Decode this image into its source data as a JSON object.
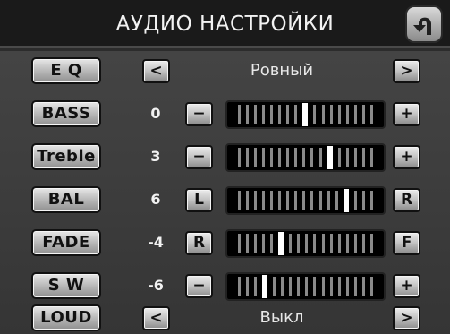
{
  "header": {
    "title": "АУДИО НАСТРОЙКИ",
    "back_icon": "back-arrow-icon"
  },
  "eq": {
    "label": "E Q",
    "prev": "<",
    "next": ">",
    "preset": "Ровный"
  },
  "rows": [
    {
      "id": "bass",
      "label": "BASS",
      "value": "0",
      "minus": "−",
      "plus": "+",
      "position": 0.5
    },
    {
      "id": "treble",
      "label": "Treble",
      "value": "3",
      "minus": "−",
      "plus": "+",
      "position": 0.69
    },
    {
      "id": "bal",
      "label": "BAL",
      "value": "6",
      "minus": "L",
      "plus": "R",
      "position": 0.81
    },
    {
      "id": "fade",
      "label": "FADE",
      "value": "-4",
      "minus": "R",
      "plus": "F",
      "position": 0.31
    },
    {
      "id": "sw",
      "label": "S W",
      "value": "-6",
      "minus": "−",
      "plus": "+",
      "position": 0.19
    }
  ],
  "loud": {
    "label": "LOUD",
    "prev": "<",
    "next": ">",
    "state": "Выкл"
  }
}
